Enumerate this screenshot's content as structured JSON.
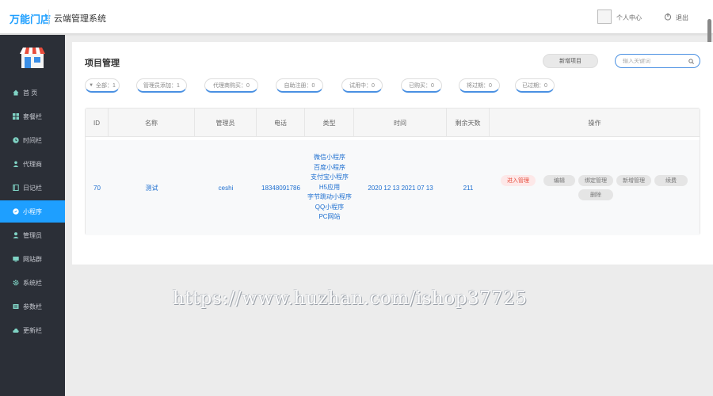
{
  "header": {
    "logo_text": "万能门店",
    "system_title": "云端管理系统",
    "user_label": "个人中心",
    "logout_label": "退出"
  },
  "sidebar": {
    "items": [
      {
        "label": "首 页",
        "icon": "home-icon"
      },
      {
        "label": "套餐栏",
        "icon": "grid-icon"
      },
      {
        "label": "时间栏",
        "icon": "clock-icon"
      },
      {
        "label": "代理商",
        "icon": "user-icon"
      },
      {
        "label": "日记栏",
        "icon": "book-icon"
      },
      {
        "label": "小程序",
        "icon": "miniapp-icon",
        "active": true
      },
      {
        "label": "管理员",
        "icon": "admin-icon"
      },
      {
        "label": "网站群",
        "icon": "site-icon"
      },
      {
        "label": "系统栏",
        "icon": "gear-icon"
      },
      {
        "label": "参数栏",
        "icon": "param-icon"
      },
      {
        "label": "更新栏",
        "icon": "cloud-icon"
      }
    ],
    "active_color": "#1e9fff"
  },
  "main": {
    "title": "项目管理",
    "new_button": "新增项目",
    "search_placeholder": "输入关键词",
    "filters": [
      {
        "label": "全部：1"
      },
      {
        "label": "管理员添加：1"
      },
      {
        "label": "代理商购买：0"
      },
      {
        "label": "自助注册：0"
      },
      {
        "label": "试用中：0"
      },
      {
        "label": "已购买：0"
      },
      {
        "label": "将过期：0"
      },
      {
        "label": "已过期：0"
      }
    ],
    "table": {
      "headers": [
        "ID",
        "名称",
        "管理员",
        "电话",
        "类型",
        "时间",
        "剩余天数",
        "操作"
      ],
      "rows": [
        {
          "id": "70",
          "name": "测试",
          "admin": "ceshi",
          "phone": "18348091786",
          "types": [
            "微信小程序",
            "百度小程序",
            "支付宝小程序",
            "H5应用",
            "字节跳动小程序",
            "QQ小程序",
            "PC网站"
          ],
          "time": "2020 12 13 2021 07 13",
          "remaining_days": "211",
          "ops": [
            "进入管理",
            "编辑",
            "绑定管理",
            "新增管理",
            "续费",
            "删除"
          ]
        }
      ]
    }
  },
  "watermark": "https://www.huzhan.com/ishop37725"
}
